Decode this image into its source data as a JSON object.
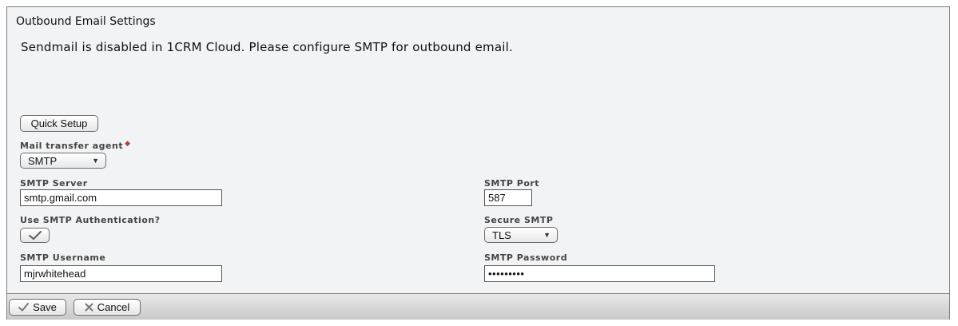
{
  "panel": {
    "title": "Outbound Email Settings",
    "notice": "Sendmail is disabled in 1CRM Cloud. Please configure SMTP for outbound email."
  },
  "form": {
    "quick_setup_label": "Quick Setup",
    "mta_label": "Mail transfer agent",
    "mta_required_icon": "required-diamond-icon",
    "mta_value": "SMTP",
    "smtp_server_label": "SMTP Server",
    "smtp_server_value": "smtp.gmail.com",
    "smtp_port_label": "SMTP Port",
    "smtp_port_value": "587",
    "use_auth_label": "Use SMTP Authentication?",
    "use_auth_checked": true,
    "secure_smtp_label": "Secure SMTP",
    "secure_smtp_value": "TLS",
    "smtp_username_label": "SMTP Username",
    "smtp_username_value": "mjrwhitehead",
    "smtp_password_label": "SMTP Password",
    "smtp_password_value": "•••••••••"
  },
  "footer": {
    "save_label": "Save",
    "save_icon": "checkmark-icon",
    "cancel_label": "Cancel",
    "cancel_icon": "cancel-x-icon"
  },
  "colors": {
    "panel_bg": "#f1f3f5",
    "border": "#7a7a7a",
    "required": "#c03a3a"
  }
}
